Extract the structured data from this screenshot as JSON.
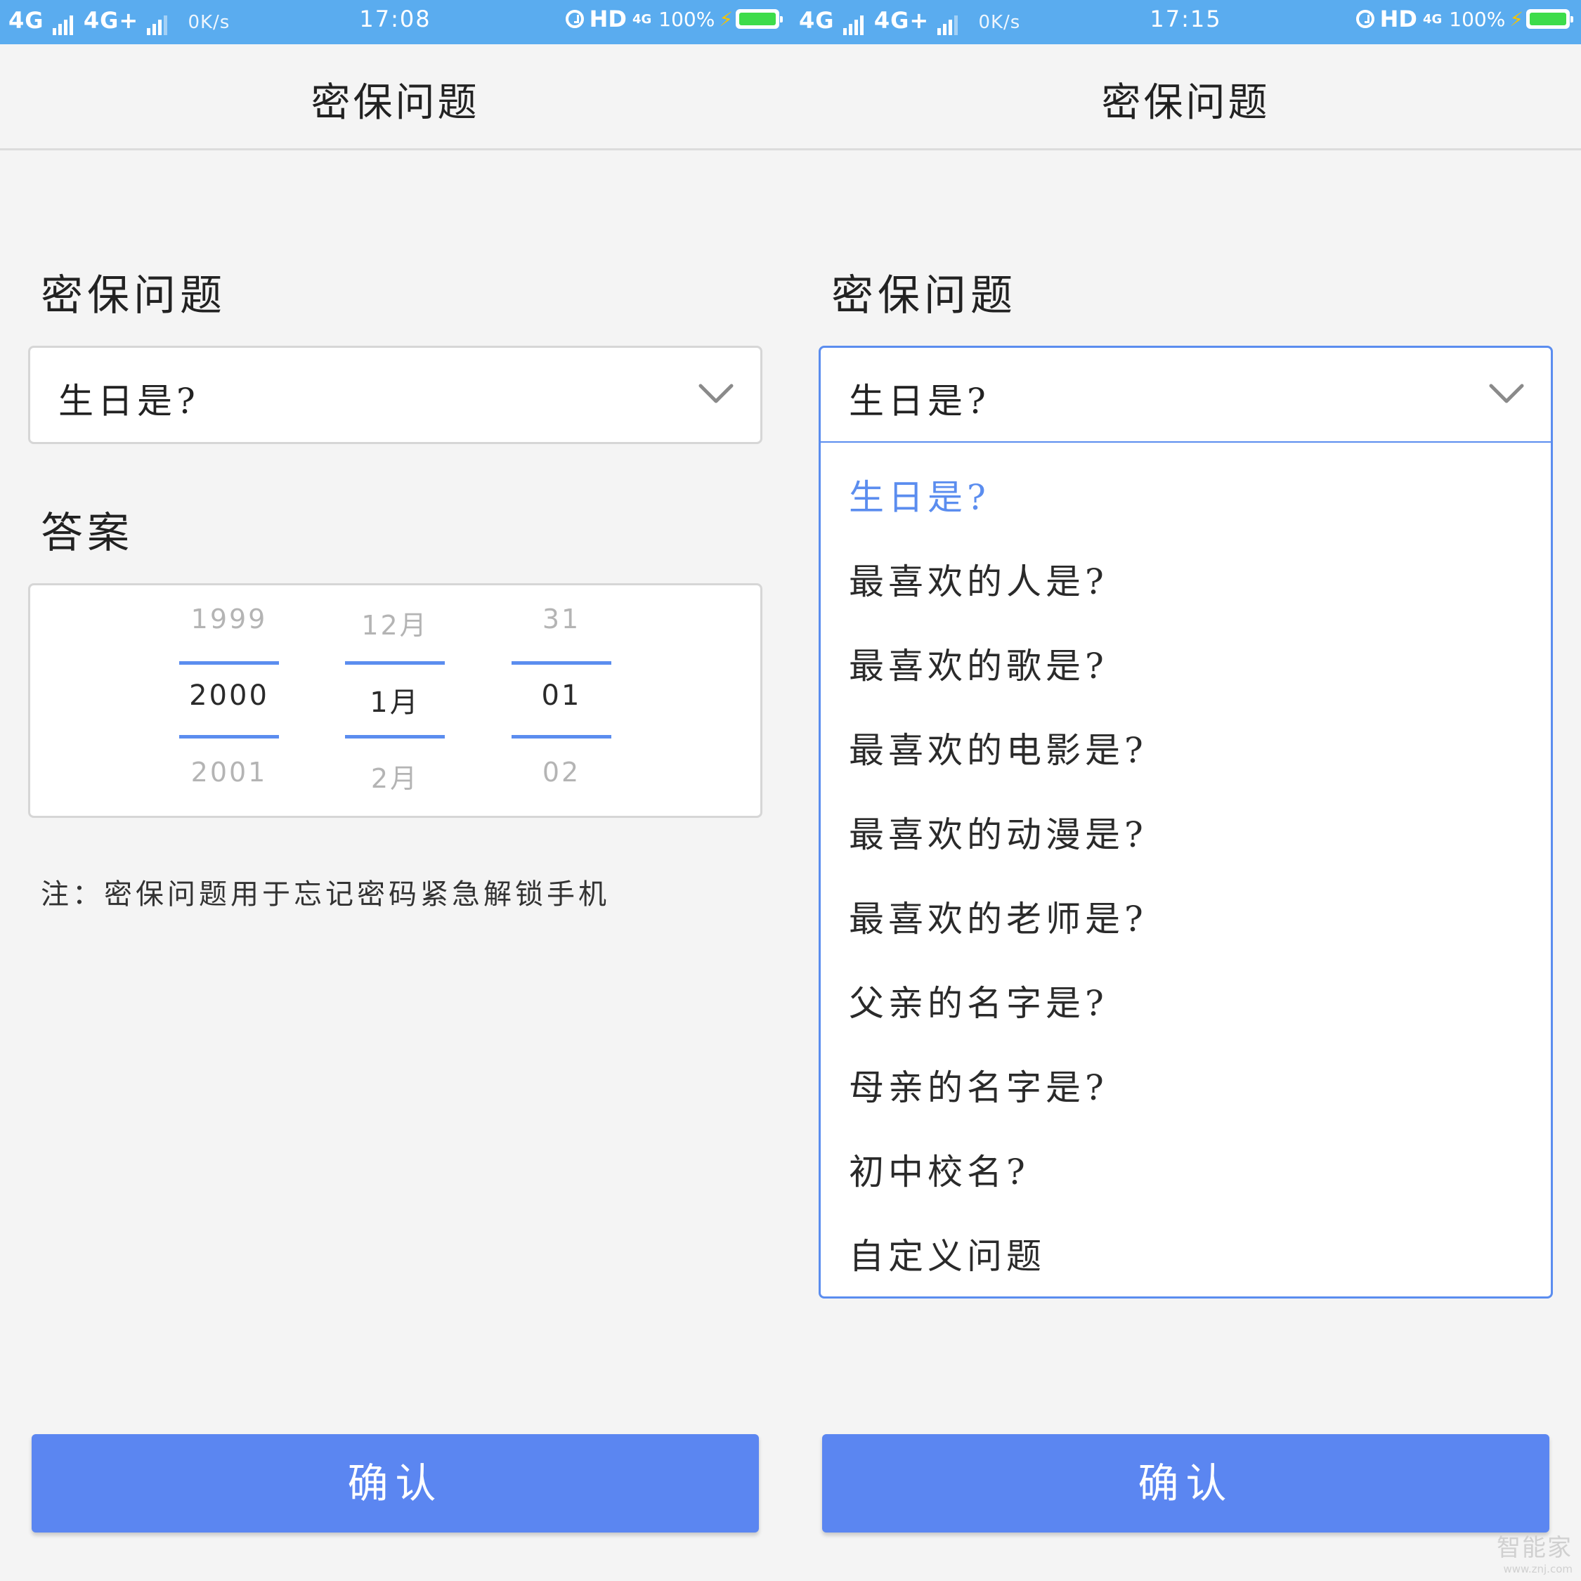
{
  "left": {
    "status": {
      "network_1": "4G",
      "network_2": "4G+",
      "speed": "0K/s",
      "time": "17:08",
      "hd": "HD",
      "net_small": "4G",
      "battery": "100%"
    },
    "title": "密保问题",
    "question_label": "密保问题",
    "select_value": "生日是?",
    "answer_label": "答案",
    "picker": {
      "year": {
        "prev": "1999",
        "current": "2000",
        "next": "2001"
      },
      "month": {
        "prev": "12月",
        "current": "1月",
        "next": "2月"
      },
      "day": {
        "prev": "31",
        "current": "01",
        "next": "02"
      }
    },
    "note": "注：密保问题用于忘记密码紧急解锁手机",
    "confirm_label": "确认"
  },
  "right": {
    "status": {
      "network_1": "4G",
      "network_2": "4G+",
      "speed": "0K/s",
      "time": "17:15",
      "hd": "HD",
      "net_small": "4G",
      "battery": "100%"
    },
    "title": "密保问题",
    "question_label": "密保问题",
    "select_value": "生日是?",
    "options": [
      "生日是?",
      "最喜欢的人是?",
      "最喜欢的歌是?",
      "最喜欢的电影是?",
      "最喜欢的动漫是?",
      "最喜欢的老师是?",
      "父亲的名字是?",
      "母亲的名字是?",
      "初中校名?",
      "自定义问题"
    ],
    "selected_index": 0,
    "confirm_label": "确认"
  },
  "watermark": {
    "logo": "智能家",
    "url": "www.znj.com"
  },
  "colors": {
    "accent": "#5b8def",
    "button": "#5b86f1",
    "statusbar": "#5aacef",
    "background": "#f4f4f4"
  },
  "icons": {
    "dropdown": "chevron-down-icon",
    "alarm": "alarm-icon",
    "battery": "battery-icon",
    "charging": "bolt-icon"
  }
}
